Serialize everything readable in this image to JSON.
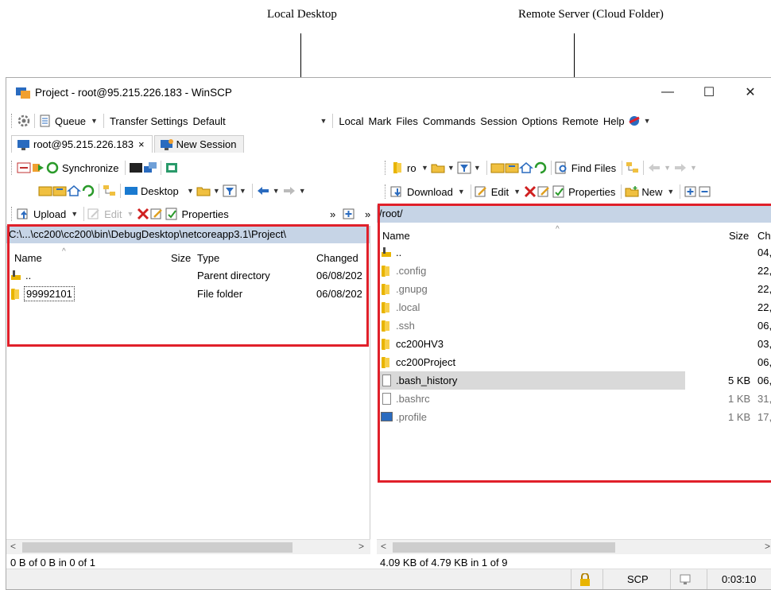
{
  "annotations": {
    "local": "Local Desktop",
    "remote": "Remote Server (Cloud Folder)"
  },
  "window": {
    "title": "Project - root@95.215.226.183 - WinSCP",
    "minimize": "—",
    "maximize": "☐",
    "close": "✕"
  },
  "toolbar1": {
    "queue": "Queue",
    "transfer_settings": "Transfer Settings",
    "transfer_value": "Default",
    "menu": [
      "Local",
      "Mark",
      "Files",
      "Commands",
      "Session",
      "Options",
      "Remote",
      "Help"
    ]
  },
  "tabs": {
    "session": "root@95.215.226.183",
    "session_close": "×",
    "new_session": "New Session"
  },
  "local_toolbar": {
    "synchronize": "Synchronize",
    "drive": "Desktop",
    "upload": "Upload",
    "edit": "Edit",
    "properties": "Properties",
    "more": "»"
  },
  "remote_toolbar": {
    "drive": "ro",
    "find_files": "Find Files",
    "download": "Download",
    "edit": "Edit",
    "properties": "Properties",
    "new": "New",
    "more": "»"
  },
  "local_pane": {
    "path": "C:\\...\\cc200\\cc200\\bin\\DebugDesktop\\netcoreapp3.1\\Project\\",
    "columns": {
      "name": "Name",
      "size": "Size",
      "type": "Type",
      "changed": "Changed"
    },
    "rows": [
      {
        "name": "..",
        "size": "",
        "type": "Parent directory",
        "changed": "06/08/202"
      },
      {
        "name": "99992101",
        "size": "",
        "type": "File folder",
        "changed": "06/08/202"
      }
    ],
    "status": "0 B of 0 B in 0 of 1"
  },
  "remote_pane": {
    "path": "/root/",
    "columns": {
      "name": "Name",
      "size": "Size",
      "changed": "Ch"
    },
    "rows": [
      {
        "name": "..",
        "size": "",
        "changed": "04,"
      },
      {
        "name": ".config",
        "size": "",
        "changed": "22,"
      },
      {
        "name": ".gnupg",
        "size": "",
        "changed": "22,"
      },
      {
        "name": ".local",
        "size": "",
        "changed": "22,"
      },
      {
        "name": ".ssh",
        "size": "",
        "changed": "06,"
      },
      {
        "name": "cc200HV3",
        "size": "",
        "changed": "03,"
      },
      {
        "name": "cc200Project",
        "size": "",
        "changed": "06,"
      },
      {
        "name": ".bash_history",
        "size": "5 KB",
        "changed": "06,"
      },
      {
        "name": ".bashrc",
        "size": "1 KB",
        "changed": "31,"
      },
      {
        "name": ".profile",
        "size": "1 KB",
        "changed": "17,"
      }
    ],
    "status": "4.09 KB of 4.79 KB in 1 of 9"
  },
  "statusbar": {
    "protocol": "SCP",
    "time": "0:03:10"
  },
  "colors": {
    "path_bar": "#c6d4e6",
    "highlight_box": "#e0202a",
    "selected_row": "#d9d9d9"
  }
}
